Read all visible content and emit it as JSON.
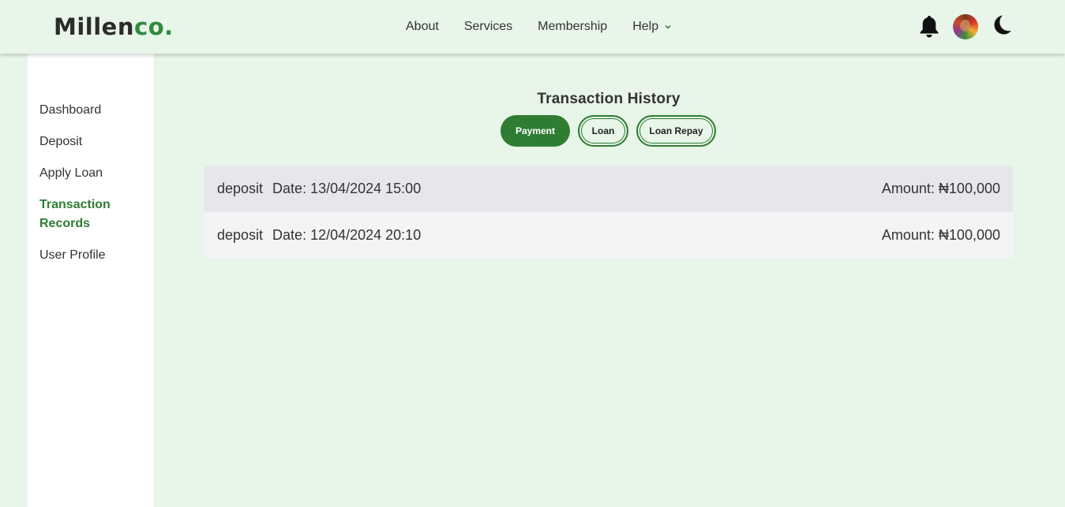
{
  "brand": {
    "name_dark": "Millen",
    "name_green": "co."
  },
  "nav": {
    "items": [
      {
        "label": "About"
      },
      {
        "label": "Services"
      },
      {
        "label": "Membership"
      },
      {
        "label": "Help"
      }
    ]
  },
  "header_icons": [
    "bell-icon",
    "avatar",
    "moon-icon"
  ],
  "sidebar": {
    "items": [
      {
        "label": "Dashboard",
        "active": false
      },
      {
        "label": "Deposit",
        "active": false
      },
      {
        "label": "Apply Loan",
        "active": false
      },
      {
        "label": "Transaction Records",
        "active": true
      },
      {
        "label": "User Profile",
        "active": false
      }
    ]
  },
  "main": {
    "title": "Transaction History",
    "tabs": [
      {
        "label": "Payment",
        "active": true
      },
      {
        "label": "Loan",
        "active": false
      },
      {
        "label": "Loan Repay",
        "active": false
      }
    ],
    "transactions": [
      {
        "type": "deposit",
        "date": "Date: 13/04/2024 15:00",
        "amount": "Amount: ₦100,000"
      },
      {
        "type": "deposit",
        "date": "Date: 12/04/2024 20:10",
        "amount": "Amount: ₦100,000"
      }
    ]
  },
  "colors": {
    "accent": "#2e7d32",
    "background": "#e8f5e9",
    "sidebar_bg": "#ffffff",
    "row_odd": "#e5e7eb",
    "row_even": "#f3f4f6"
  }
}
